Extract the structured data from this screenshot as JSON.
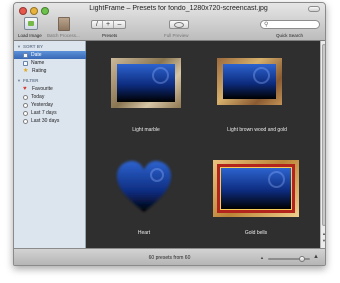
{
  "window": {
    "title": "LightFrame – Presets for fondo_1280x720-screencast.jpg"
  },
  "toolbar": {
    "load_image_label": "Load Image",
    "batch_process_label": "Batch Process...",
    "presets_label": "Presets",
    "full_preview_label": "Full Preview",
    "quick_search_label": "Quick Search",
    "presets_buttons": [
      "/",
      "+",
      "–"
    ],
    "search": {
      "value": "",
      "placeholder": ""
    }
  },
  "sidebar": {
    "sort_by": {
      "title": "SORT BY",
      "items": [
        {
          "label": "Date",
          "icon": "square-icon",
          "selected": true
        },
        {
          "label": "Name",
          "icon": "square-icon",
          "selected": false
        },
        {
          "label": "Rating",
          "icon": "star-icon",
          "selected": false
        }
      ]
    },
    "filter": {
      "title": "FILTER",
      "items": [
        {
          "label": "Favourite",
          "icon": "heart-icon"
        },
        {
          "label": "Today",
          "icon": "circle-icon"
        },
        {
          "label": "Yesterday",
          "icon": "circle-icon"
        },
        {
          "label": "Last 7 days",
          "icon": "circle-icon"
        },
        {
          "label": "Last 30 days",
          "icon": "circle-icon"
        }
      ]
    }
  },
  "presets": [
    {
      "name": "Light marble"
    },
    {
      "name": "Light brown wood and gold"
    },
    {
      "name": "Heart"
    },
    {
      "name": "Gold bells"
    }
  ],
  "status": {
    "count_text": "60 presets from 60",
    "zoom_level": 0.85
  },
  "colors": {
    "selection": "#3768b5",
    "background": "#2f2f2f",
    "image_blue": "#2d63cf"
  }
}
